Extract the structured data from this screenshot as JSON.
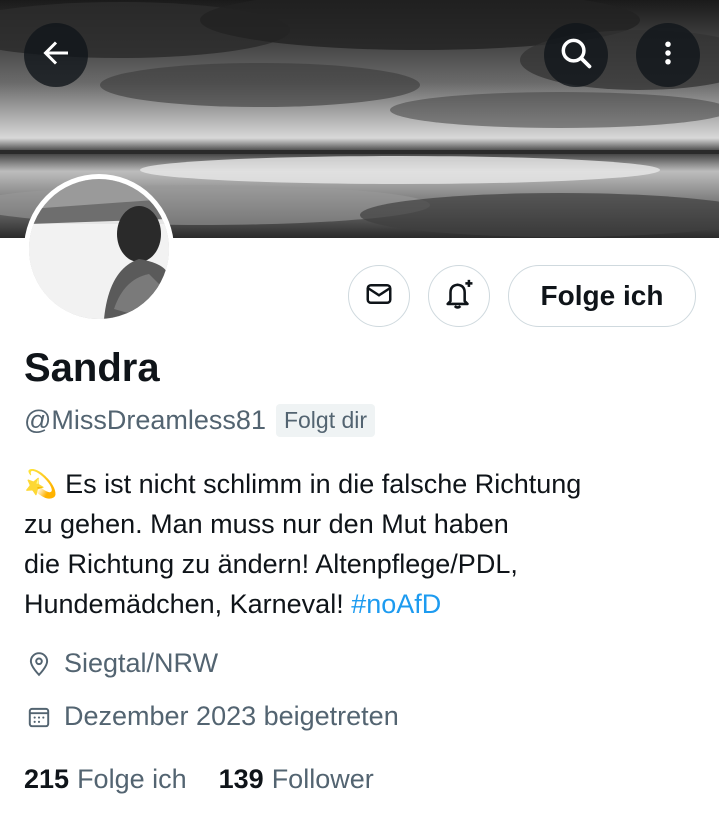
{
  "profile": {
    "name": "Sandra",
    "handle": "@MissDreamless81",
    "follows_you_badge": "Folgt dir",
    "bio_lines": [
      "💫 Es ist nicht schlimm in die falsche Richtung",
      "zu gehen. Man muss nur den Mut haben",
      "die Richtung zu ändern! Altenpflege/PDL,",
      "Hundemädchen, Karneval! "
    ],
    "bio_hashtag": "#noAfD",
    "location": "Siegtal/NRW",
    "joined": "Dezember 2023 beigetreten"
  },
  "actions": {
    "follow_label": "Folge ich",
    "message_icon": "envelope-icon",
    "notify_icon": "bell-plus-icon"
  },
  "header": {
    "back_icon": "arrow-left-icon",
    "search_icon": "search-icon",
    "more_icon": "more-vertical-icon"
  },
  "stats": {
    "following_count": "215",
    "following_label": "Folge ich",
    "followers_count": "139",
    "followers_label": "Follower"
  },
  "colors": {
    "accent": "#1d9bf0",
    "text_primary": "#0f1419",
    "text_secondary": "#536471",
    "border": "#cfd9de"
  }
}
